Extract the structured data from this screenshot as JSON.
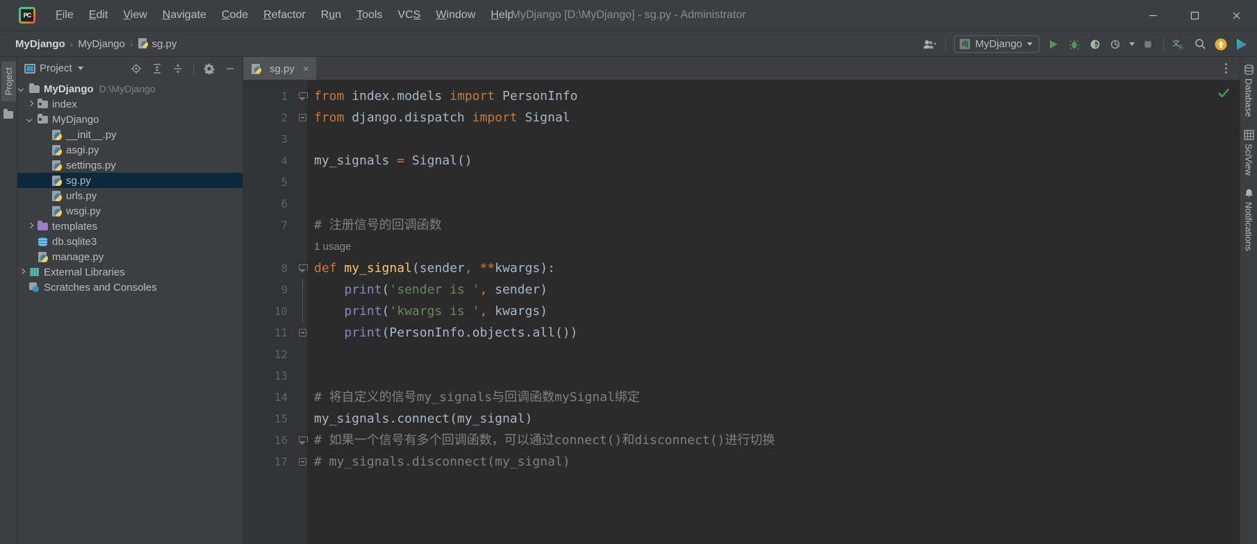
{
  "window": {
    "title": "MyDjango [D:\\MyDjango] - sg.py - Administrator",
    "minimize_label": "minimize-window",
    "maximize_label": "maximize-window",
    "close_label": "close-window"
  },
  "menu": [
    {
      "label": "File",
      "mnemonic": "F"
    },
    {
      "label": "Edit",
      "mnemonic": "E"
    },
    {
      "label": "View",
      "mnemonic": "V"
    },
    {
      "label": "Navigate",
      "mnemonic": "N"
    },
    {
      "label": "Code",
      "mnemonic": "C"
    },
    {
      "label": "Refactor",
      "mnemonic": "R"
    },
    {
      "label": "Run",
      "mnemonic": "u"
    },
    {
      "label": "Tools",
      "mnemonic": "T"
    },
    {
      "label": "VCS",
      "mnemonic": "S"
    },
    {
      "label": "Window",
      "mnemonic": "W"
    },
    {
      "label": "Help",
      "mnemonic": "H"
    }
  ],
  "breadcrumb": {
    "items": [
      "MyDjango",
      "MyDjango",
      "sg.py"
    ],
    "separator": "›"
  },
  "toolbar": {
    "run_config_label": "MyDjango",
    "run_config_icon": "django-icon",
    "buttons": [
      {
        "name": "user-account-icon",
        "label": ""
      },
      {
        "name": "run-button",
        "label": ""
      },
      {
        "name": "debug-button",
        "label": ""
      },
      {
        "name": "run-with-coverage-button",
        "label": ""
      },
      {
        "name": "profile-button",
        "label": ""
      },
      {
        "name": "stop-button",
        "label": ""
      },
      {
        "name": "translate-icon",
        "label": ""
      },
      {
        "name": "search-everywhere-icon",
        "label": ""
      },
      {
        "name": "update-project-icon",
        "label": ""
      },
      {
        "name": "ide-assistant-icon",
        "label": ""
      }
    ]
  },
  "left_strip": {
    "project_tab": "Project"
  },
  "project_panel": {
    "title": "Project",
    "toolbar": [
      {
        "name": "locate-file-icon"
      },
      {
        "name": "expand-all-icon"
      },
      {
        "name": "collapse-all-icon"
      },
      {
        "name": "settings-gear-icon"
      },
      {
        "name": "hide-panel-icon"
      }
    ],
    "tree": [
      {
        "label": "MyDjango",
        "path": "D:\\MyDjango",
        "icon": "folder-icon",
        "indent": 0,
        "arrow": "open",
        "bold": true,
        "selected": false
      },
      {
        "label": "index",
        "path": "",
        "icon": "module-folder-icon",
        "indent": 1,
        "arrow": "closed",
        "bold": false,
        "selected": false
      },
      {
        "label": "MyDjango",
        "path": "",
        "icon": "module-folder-icon",
        "indent": 1,
        "arrow": "open",
        "bold": false,
        "selected": false
      },
      {
        "label": "__init__.py",
        "path": "",
        "icon": "python-file-icon",
        "indent": 2,
        "arrow": "none",
        "bold": false,
        "selected": false
      },
      {
        "label": "asgi.py",
        "path": "",
        "icon": "python-file-icon",
        "indent": 2,
        "arrow": "none",
        "bold": false,
        "selected": false
      },
      {
        "label": "settings.py",
        "path": "",
        "icon": "python-file-icon",
        "indent": 2,
        "arrow": "none",
        "bold": false,
        "selected": false
      },
      {
        "label": "sg.py",
        "path": "",
        "icon": "python-file-icon",
        "indent": 2,
        "arrow": "none",
        "bold": false,
        "selected": true
      },
      {
        "label": "urls.py",
        "path": "",
        "icon": "python-file-icon",
        "indent": 2,
        "arrow": "none",
        "bold": false,
        "selected": false
      },
      {
        "label": "wsgi.py",
        "path": "",
        "icon": "python-file-icon",
        "indent": 2,
        "arrow": "none",
        "bold": false,
        "selected": false
      },
      {
        "label": "templates",
        "path": "",
        "icon": "templates-folder-icon",
        "indent": 1,
        "arrow": "closed",
        "bold": false,
        "selected": false
      },
      {
        "label": "db.sqlite3",
        "path": "",
        "icon": "database-file-icon",
        "indent": 1,
        "arrow": "none",
        "bold": false,
        "selected": false
      },
      {
        "label": "manage.py",
        "path": "",
        "icon": "python-file-icon",
        "indent": 1,
        "arrow": "none",
        "bold": false,
        "selected": false
      },
      {
        "label": "External Libraries",
        "path": "",
        "icon": "libraries-icon",
        "indent": 0,
        "arrow": "closed",
        "bold": false,
        "selected": false
      },
      {
        "label": "Scratches and Consoles",
        "path": "",
        "icon": "scratches-icon",
        "indent": 0,
        "arrow": "none",
        "bold": false,
        "selected": false
      }
    ]
  },
  "editor": {
    "tab": {
      "label": "sg.py",
      "icon": "python-file-icon",
      "close": "×"
    },
    "inspection_status": "ok-checkmark",
    "lines": [
      {
        "num": "1",
        "fold": "tri",
        "type": "code",
        "text": "from index.models import PersonInfo"
      },
      {
        "num": "2",
        "fold": "end",
        "type": "code",
        "text": "from django.dispatch import Signal"
      },
      {
        "num": "3",
        "fold": "none",
        "type": "code",
        "text": ""
      },
      {
        "num": "4",
        "fold": "none",
        "type": "code",
        "text": "my_signals = Signal()"
      },
      {
        "num": "5",
        "fold": "none",
        "type": "code",
        "text": ""
      },
      {
        "num": "6",
        "fold": "none",
        "type": "code",
        "text": ""
      },
      {
        "num": "7",
        "fold": "none",
        "type": "code",
        "text": "# 注册信号的回调函数"
      },
      {
        "num": "",
        "fold": "none",
        "type": "inlay",
        "text": "1 usage"
      },
      {
        "num": "8",
        "fold": "tri",
        "type": "code",
        "text": "def my_signal(sender, **kwargs):"
      },
      {
        "num": "9",
        "fold": "bar",
        "type": "code",
        "text": "    print('sender is ', sender)"
      },
      {
        "num": "10",
        "fold": "bar",
        "type": "code",
        "text": "    print('kwargs is ', kwargs)"
      },
      {
        "num": "11",
        "fold": "end",
        "type": "code",
        "text": "    print(PersonInfo.objects.all())"
      },
      {
        "num": "12",
        "fold": "none",
        "type": "code",
        "text": ""
      },
      {
        "num": "13",
        "fold": "none",
        "type": "code",
        "text": ""
      },
      {
        "num": "14",
        "fold": "none",
        "type": "code",
        "text": "# 将自定义的信号my_signals与回调函数mySignal绑定"
      },
      {
        "num": "15",
        "fold": "none",
        "type": "code",
        "text": "my_signals.connect(my_signal)"
      },
      {
        "num": "16",
        "fold": "tri",
        "type": "code",
        "text": "# 如果一个信号有多个回调函数，可以通过connect()和disconnect()进行切换"
      },
      {
        "num": "17",
        "fold": "end",
        "type": "code",
        "text": "# my_signals.disconnect(my_signal)"
      }
    ]
  },
  "right_strip": {
    "tabs": [
      {
        "label": "Database",
        "icon": "database-icon"
      },
      {
        "label": "SciView",
        "icon": "grid-icon"
      },
      {
        "label": "Notifications",
        "icon": "bell-icon"
      }
    ]
  },
  "colors": {
    "background": "#2b2b2b",
    "panel": "#3c3f41",
    "selection": "#0d293e",
    "keyword": "#cc7832",
    "function": "#ffc66d",
    "string": "#6a8759",
    "comment": "#808080",
    "identifier": "#a9b7c6",
    "call": "#8888c6",
    "accent_green": "#499c54"
  }
}
